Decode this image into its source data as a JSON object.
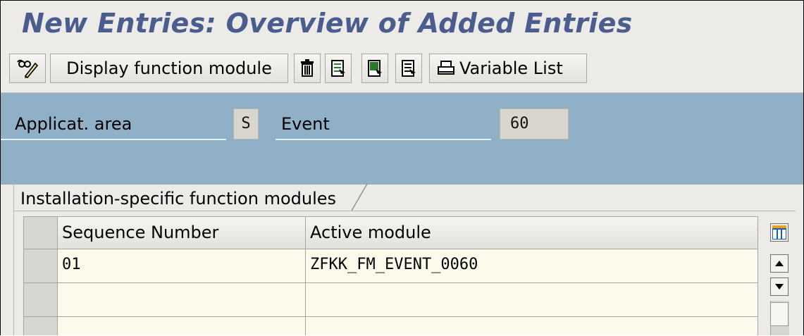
{
  "window": {
    "title": "New Entries: Overview of Added Entries"
  },
  "toolbar": {
    "display_fm_label": "Display function module",
    "variable_list_label": "Variable List"
  },
  "header": {
    "applic_area_label": "Applicat. area",
    "applic_area_value": "S",
    "event_label": "Event",
    "event_value": "60"
  },
  "tab": {
    "label": "Installation-specific function modules"
  },
  "table": {
    "columns": [
      "Sequence Number",
      "Active module"
    ],
    "rows": [
      [
        "01",
        "ZFKK_FM_EVENT_0060"
      ],
      [
        "",
        ""
      ],
      [
        "",
        ""
      ]
    ]
  },
  "icons": [
    "edit-glasses-icon",
    "delete-icon",
    "select-all-icon",
    "select-block-icon",
    "deselect-all-icon",
    "print-icon",
    "column-config-icon",
    "scroll-up-icon",
    "scroll-down-icon"
  ],
  "colors": {
    "title": "#4a5d8e",
    "header_bg": "#8fb0c6",
    "input_row_bg": "#fcfaea"
  }
}
